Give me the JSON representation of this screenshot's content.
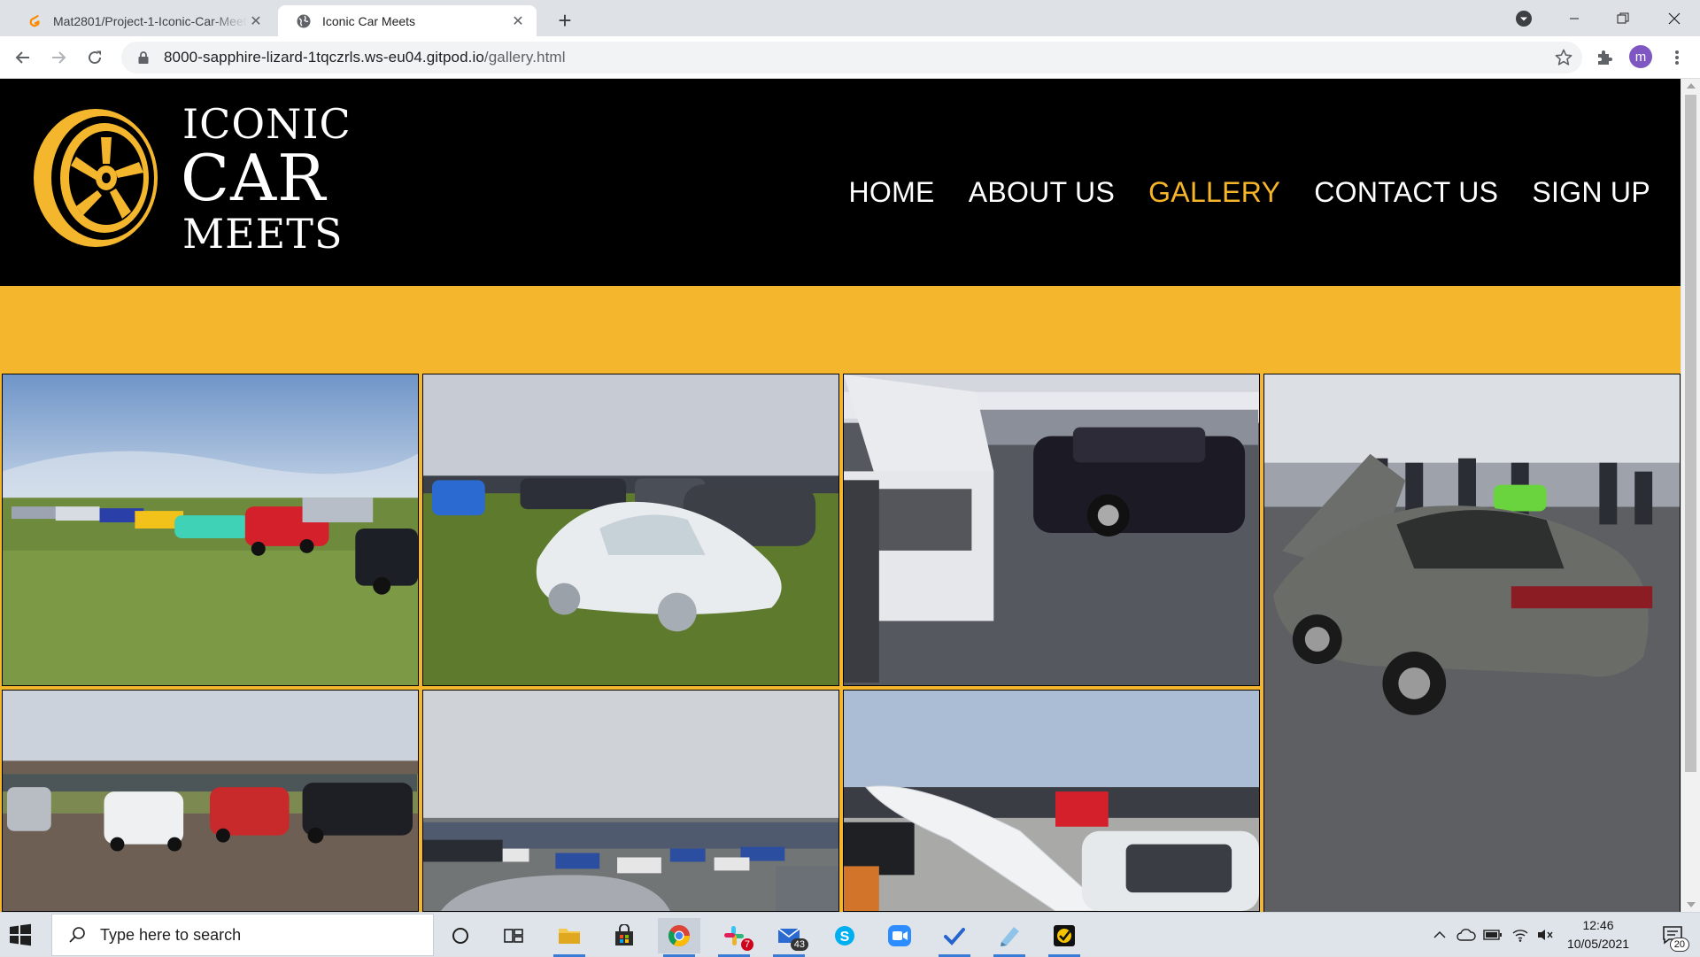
{
  "browser": {
    "tabs": [
      {
        "title": "Mat2801/Project-1-Iconic-Car-Meets",
        "active": false,
        "favicon": "gitpod-icon"
      },
      {
        "title": "Iconic Car Meets",
        "active": true,
        "favicon": "globe-icon"
      }
    ],
    "url_host": "8000-sapphire-lizard-1tqczrls.ws-eu04.gitpod.io",
    "url_path": "/gallery.html",
    "profile_initial": "m"
  },
  "site": {
    "logo": {
      "line1": "ICONIC",
      "line2": "CAR",
      "line3": "MEETS"
    },
    "nav": [
      {
        "label": "HOME",
        "current": false
      },
      {
        "label": "ABOUT US",
        "current": false
      },
      {
        "label": "GALLERY",
        "current": true
      },
      {
        "label": "CONTACT US",
        "current": false
      },
      {
        "label": "SIGN UP",
        "current": false
      }
    ],
    "colors": {
      "accent": "#f7b52a",
      "background": "#000000",
      "gallery_border": "#f4b62c"
    }
  },
  "taskbar": {
    "search_placeholder": "Type here to search",
    "apps": [
      "task-view",
      "file-explorer",
      "microsoft-store",
      "chrome",
      "slack",
      "mail",
      "skype",
      "zoom",
      "todo",
      "notepad",
      "norton"
    ],
    "slack_badge": "7",
    "mail_badge": "43",
    "time": "12:46",
    "date": "10/05/2021",
    "notifications": "20"
  }
}
